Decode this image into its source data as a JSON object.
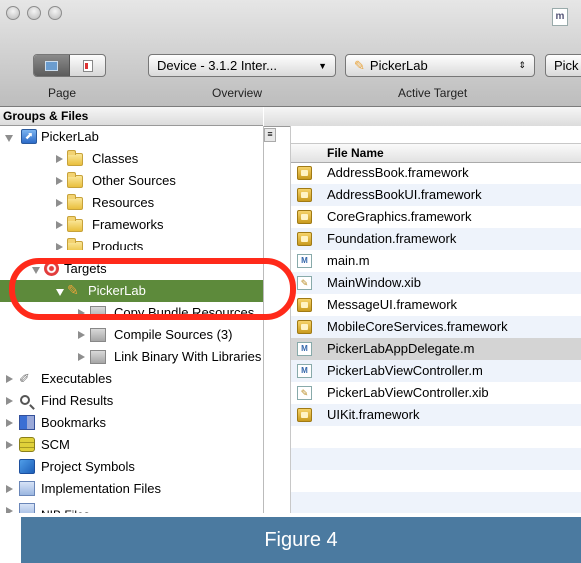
{
  "toolbar": {
    "document_icon_glyph": "m",
    "overview_popup": "Device - 3.1.2 Inter...",
    "active_target_popup": "PickerLab",
    "partial_popup": "Pick",
    "labels": {
      "page": "Page",
      "overview": "Overview",
      "active_target": "Active Target"
    }
  },
  "sidebar": {
    "header": "Groups & Files",
    "items": [
      {
        "label": "PickerLab",
        "icon": "project-icon",
        "level": 0,
        "expanded": true
      },
      {
        "label": "Classes",
        "icon": "folder-icon",
        "level": 1
      },
      {
        "label": "Other Sources",
        "icon": "folder-icon",
        "level": 1
      },
      {
        "label": "Resources",
        "icon": "folder-icon",
        "level": 1
      },
      {
        "label": "Frameworks",
        "icon": "folder-icon",
        "level": 1
      },
      {
        "label": "Products",
        "icon": "folder-icon",
        "level": 1
      },
      {
        "label": "Targets",
        "icon": "target-icon",
        "level": 0,
        "expanded": true
      },
      {
        "label": "PickerLab",
        "icon": "app-target-icon",
        "level": 1,
        "expanded": true,
        "selected": true
      },
      {
        "label": "Copy Bundle Resources",
        "icon": "build-phase-icon",
        "level": 2
      },
      {
        "label": "Compile Sources (3)",
        "icon": "build-phase-icon",
        "level": 2
      },
      {
        "label": "Link Binary With Libraries",
        "icon": "build-phase-icon",
        "level": 2
      },
      {
        "label": "Executables",
        "icon": "executables-icon",
        "level": 0
      },
      {
        "label": "Find Results",
        "icon": "magnifier-icon",
        "level": 0
      },
      {
        "label": "Bookmarks",
        "icon": "bookmarks-icon",
        "level": 0
      },
      {
        "label": "SCM",
        "icon": "scm-icon",
        "level": 0
      },
      {
        "label": "Project Symbols",
        "icon": "project-symbols-icon",
        "level": 0
      },
      {
        "label": "Implementation Files",
        "icon": "implementation-files-icon",
        "level": 0
      },
      {
        "label": "NIB Files",
        "icon": "nib-files-icon",
        "level": 0
      }
    ]
  },
  "file_list": {
    "column_header": "File Name",
    "files": [
      {
        "name": "AddressBook.framework",
        "icon": "framework-icon"
      },
      {
        "name": "AddressBookUI.framework",
        "icon": "framework-icon"
      },
      {
        "name": "CoreGraphics.framework",
        "icon": "framework-icon"
      },
      {
        "name": "Foundation.framework",
        "icon": "framework-icon"
      },
      {
        "name": "main.m",
        "icon": "m-file-icon"
      },
      {
        "name": "MainWindow.xib",
        "icon": "xib-file-icon"
      },
      {
        "name": "MessageUI.framework",
        "icon": "framework-icon"
      },
      {
        "name": "MobileCoreServices.framework",
        "icon": "framework-icon"
      },
      {
        "name": "PickerLabAppDelegate.m",
        "icon": "m-file-icon",
        "highlighted": true
      },
      {
        "name": "PickerLabViewController.m",
        "icon": "m-file-icon"
      },
      {
        "name": "PickerLabViewController.xib",
        "icon": "xib-file-icon"
      },
      {
        "name": "UIKit.framework",
        "icon": "framework-icon"
      }
    ]
  },
  "caption": "Figure 4",
  "colors": {
    "selection": "#5d8a3b",
    "highlight_ring": "#ff2a1a",
    "caption_bg": "#4b7aa0"
  }
}
